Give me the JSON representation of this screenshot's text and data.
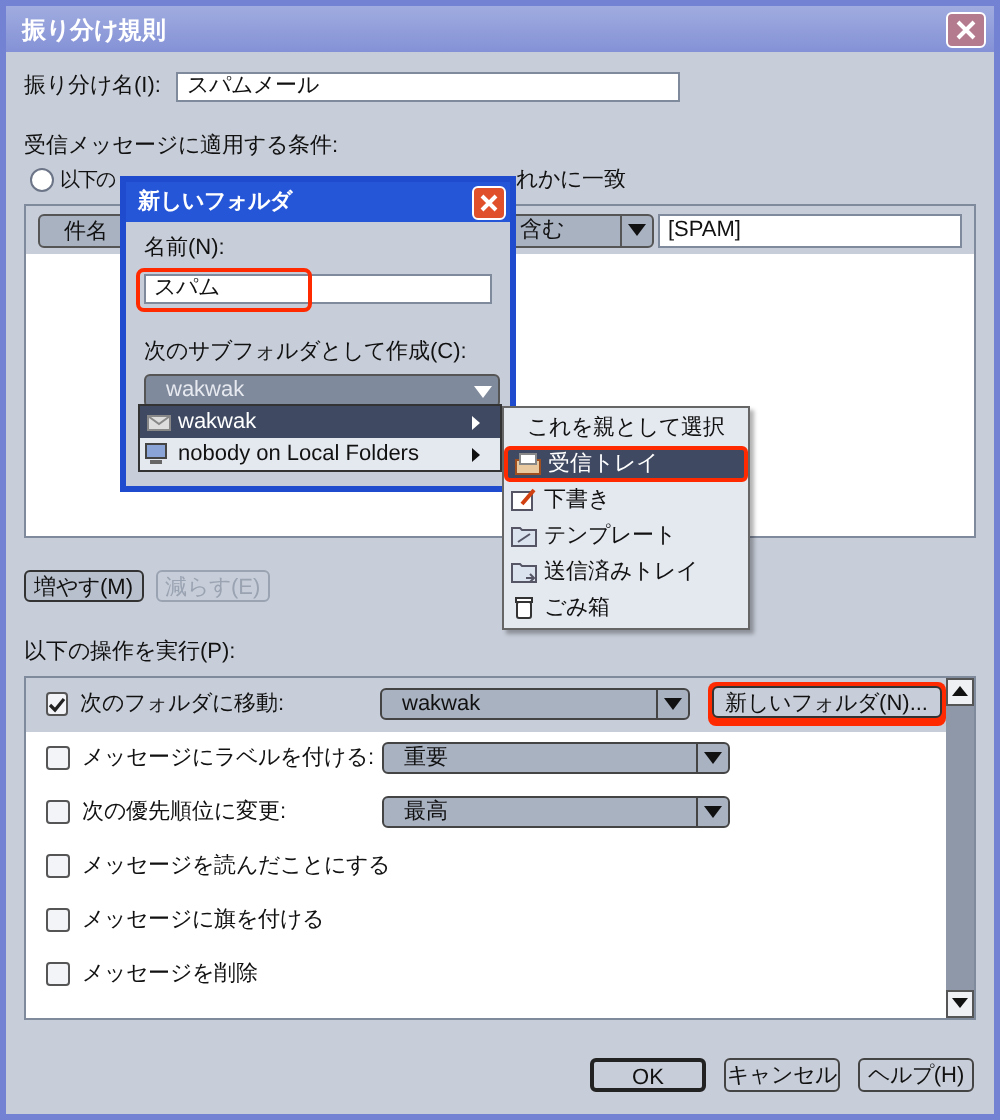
{
  "window": {
    "title": "振り分け規則"
  },
  "rule_name": {
    "label": "振り分け名(I):",
    "value": "スパムメール"
  },
  "conditions": {
    "heading": "受信メッセージに適用する条件:",
    "radio": {
      "label": "以下の",
      "selected": false
    },
    "radio_fragment": "れかに一致",
    "rows": [
      {
        "field": "件名",
        "operator": "含む",
        "value": "[SPAM]"
      }
    ],
    "add_button": {
      "label": "増やす(M)",
      "disabled": false
    },
    "remove_button": {
      "label": "減らす(E)",
      "disabled": true
    }
  },
  "actions": {
    "heading": "以下の操作を実行(P):",
    "items": [
      {
        "kind": "dropdown",
        "label": "次のフォルダに移動:",
        "checked": true,
        "selected": true,
        "value": "wakwak",
        "button": {
          "label": "新しいフォルダ(N)...",
          "highlighted": true
        }
      },
      {
        "kind": "dropdown",
        "label": "メッセージにラベルを付ける:",
        "checked": false,
        "selected": false,
        "value": "重要"
      },
      {
        "kind": "dropdown",
        "label": "次の優先順位に変更:",
        "checked": false,
        "selected": false,
        "value": "最高"
      },
      {
        "kind": "plain",
        "label": "メッセージを読んだことにする",
        "checked": false,
        "selected": false
      },
      {
        "kind": "plain",
        "label": "メッセージに旗を付ける",
        "checked": false,
        "selected": false
      },
      {
        "kind": "plain",
        "label": "メッセージを削除",
        "checked": false,
        "selected": false
      }
    ]
  },
  "footer_buttons": [
    {
      "label": "OK",
      "default": true
    },
    {
      "label": "キャンセル",
      "default": false
    },
    {
      "label": "ヘルプ(H)",
      "default": false
    }
  ],
  "new_folder_dialog": {
    "title": "新しいフォルダ",
    "name_label": "名前(N):",
    "name_value": "スパム",
    "name_highlighted": true,
    "parent_label": "次のサブフォルダとして作成(C):",
    "parent_value": "wakwak",
    "menu": [
      {
        "label": "wakwak",
        "selected": true
      },
      {
        "label": "nobody on Local Folders",
        "selected": false
      }
    ],
    "submenu": [
      {
        "kind": "command",
        "label": "これを親として選択",
        "selected": false,
        "highlighted": false
      },
      {
        "kind": "inbox",
        "label": "受信トレイ",
        "selected": true,
        "highlighted": true
      },
      {
        "kind": "drafts",
        "label": "下書き",
        "selected": false,
        "highlighted": false
      },
      {
        "kind": "templates",
        "label": "テンプレート",
        "selected": false,
        "highlighted": false
      },
      {
        "kind": "sent",
        "label": "送信済みトレイ",
        "selected": false,
        "highlighted": false
      },
      {
        "kind": "trash",
        "label": "ごみ箱",
        "selected": false,
        "highlighted": false
      }
    ]
  }
}
